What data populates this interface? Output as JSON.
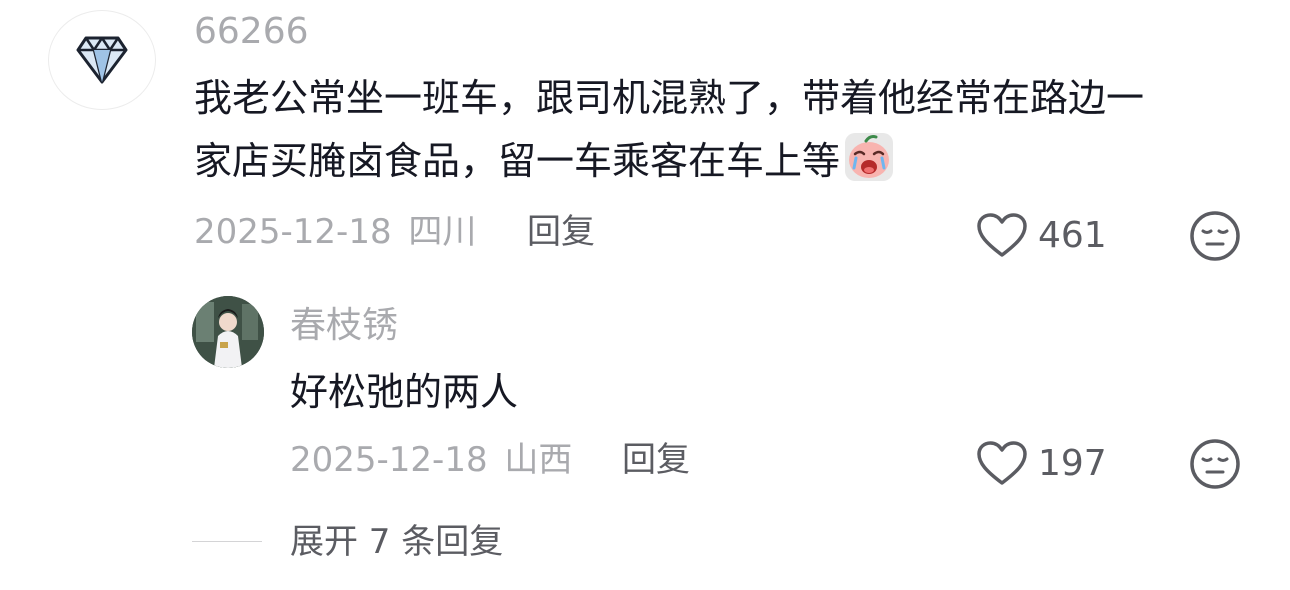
{
  "comment": {
    "username": "66266",
    "text_line1": "我老公常坐一班车，跟司机混熟了，带着他经常在路边一",
    "text_line2": "家店买腌卤食品，留一车乘客在车上等",
    "date": "2025-12-18",
    "location": "四川",
    "reply_label": "回复",
    "like_count": "461",
    "avatar_icon": "diamond-icon",
    "emoji_icon": "crying-face-emoji"
  },
  "reply": {
    "username": "春枝锈",
    "text": "好松弛的两人",
    "date": "2025-12-18",
    "location": "山西",
    "reply_label": "回复",
    "like_count": "197"
  },
  "expand": {
    "label": "展开 7 条回复"
  }
}
